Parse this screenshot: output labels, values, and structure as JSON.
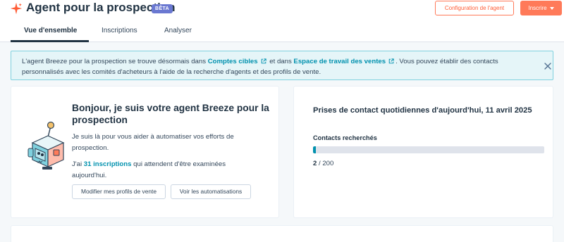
{
  "header": {
    "title": "Agent pour la prospection",
    "beta_badge": "BÊTA",
    "config_button": "Configuration de l'agent",
    "enroll_button": "Inscrire",
    "brand_color": "#ff7a59"
  },
  "tabs": [
    {
      "label": "Vue d'ensemble",
      "active": true
    },
    {
      "label": "Inscriptions",
      "active": false
    },
    {
      "label": "Analyser",
      "active": false
    }
  ],
  "alert": {
    "text_before": "L'agent Breeze pour la prospection se trouve désormais dans ",
    "link1": "Comptes cibles",
    "text_middle": " et dans ",
    "link2": "Espace de travail des ventes",
    "text_after": ". Vous pouvez établir des contacts personnalisés avec les comités d'acheteurs à l'aide de la recherche d'agents et des profils de vente.",
    "link_color": "#0091ae",
    "close_icon": "close-icon"
  },
  "agent_card": {
    "heading": "Bonjour, je suis votre agent Breeze pour la prospection",
    "intro": "Je suis là pour vous aider à automatiser vos efforts de prospection.",
    "pending_prefix": "J'ai ",
    "pending_link": "31 inscriptions",
    "pending_suffix": " qui attendent d'être examinées aujourd'hui.",
    "button_profiles": "Modifier mes profils de vente",
    "button_automations": "Voir les automatisations",
    "illustration": "robot-agent-icon"
  },
  "daily_card": {
    "title": "Prises de contact quotidiennes d'aujourd'hui, 11 avril 2025",
    "metric_label": "Contacts recherchés",
    "current": "2",
    "separator": " / ",
    "total": "200",
    "progress_fraction": 0.01,
    "progress_color": "#0091ae"
  }
}
